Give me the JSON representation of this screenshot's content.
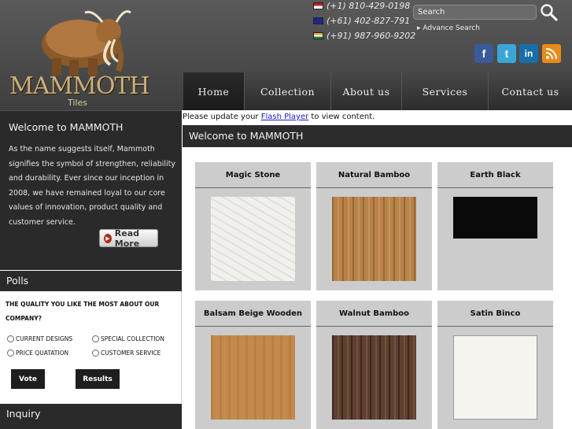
{
  "brand": {
    "name": "MAMMOTH",
    "sub": "Tiles"
  },
  "contacts": [
    {
      "flag": "us-flag-icon",
      "number": "(+1) 810-429-0198"
    },
    {
      "flag": "au-flag-icon",
      "number": "(+61) 402-827-791"
    },
    {
      "flag": "in-flag-icon",
      "number": "(+91) 987-960-9202"
    }
  ],
  "search": {
    "placeholder": "Search",
    "advance_label": "Advance Search"
  },
  "social": [
    "facebook-icon",
    "twitter-icon",
    "linkedin-icon",
    "rss-icon"
  ],
  "nav": [
    {
      "label": "Home"
    },
    {
      "label": "Collection"
    },
    {
      "label": "About us"
    },
    {
      "label": "Services"
    },
    {
      "label": "Contact us"
    }
  ],
  "welcome": {
    "title": "Welcome to MAMMOTH",
    "text": "As the name suggests itself, Mammoth signifies the symbol of strengthen, reliability and durability. Ever since our inception in 2008, we have remained loyal to our core values of innovation, product quality and customer service.",
    "read_more": "Read More"
  },
  "polls": {
    "title": "Polls",
    "question": "THE QUALITY YOU LIKE THE MOST ABOUT OUR COMPANY?",
    "options": [
      "CURRENT DESIGNS",
      "SPECIAL COLLECTION",
      "PRICE QUATATION",
      "CUSTOMER SERVICE"
    ],
    "vote": "Vote",
    "results": "Results"
  },
  "inquiry": {
    "title": "Inquiry"
  },
  "flash": {
    "before": "Please update your ",
    "link": "Flash Player",
    "after": " to view content."
  },
  "main": {
    "title": "Welcome to MAMMOTH",
    "products": [
      {
        "name": "Magic Stone",
        "color": "#f2f0ec"
      },
      {
        "name": "Natural Bamboo",
        "color": "#b8824a"
      },
      {
        "name": "Earth Black",
        "color": "#0a0a0a"
      },
      {
        "name": "Balsam Beige Wooden",
        "color": "#c48a4c"
      },
      {
        "name": "Walnut Bamboo",
        "color": "#5e4030"
      },
      {
        "name": "Satin Binco",
        "color": "#f5f4ee"
      }
    ]
  }
}
